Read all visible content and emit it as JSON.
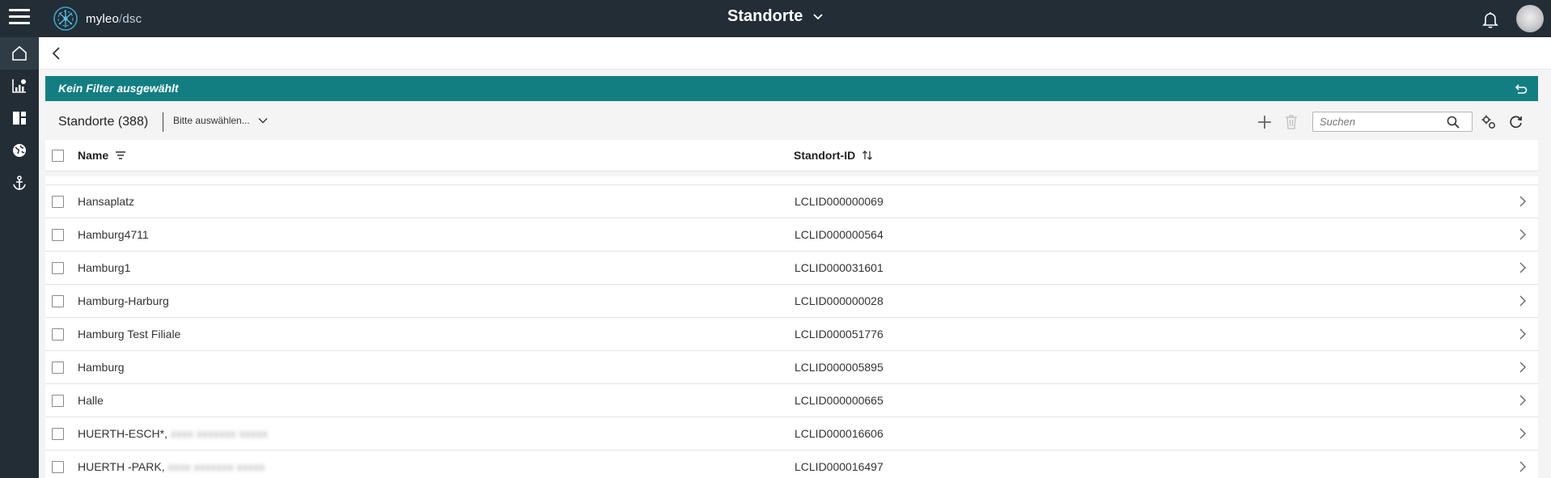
{
  "app": {
    "logo_name": "myleo",
    "logo_sep": "/",
    "logo_product": "dsc",
    "page_title": "Standorte"
  },
  "icons": {
    "menu": "hamburger-icon",
    "title_dropdown": "chevron-down-icon",
    "notifications": "bell-icon",
    "back": "chevron-left-icon",
    "filter_reset": "undo-icon",
    "add": "plus-icon",
    "delete": "trash-icon",
    "search": "search-icon",
    "settings": "settings-icon",
    "refresh": "refresh-icon",
    "row_open": "chevron-right-icon"
  },
  "rail": [
    {
      "name": "home-icon",
      "active": true
    },
    {
      "name": "chart-icon",
      "active": false
    },
    {
      "name": "dashboard-icon",
      "active": false
    },
    {
      "name": "globe-icon",
      "active": false
    },
    {
      "name": "anchor-icon",
      "active": false
    }
  ],
  "filter": {
    "text": "Kein Filter ausgewählt"
  },
  "toolbar": {
    "title": "Standorte (388)",
    "select_value": "Bitte auswählen...",
    "search_placeholder": "Suchen"
  },
  "table": {
    "columns": [
      "Name",
      "Standort-ID"
    ],
    "rows": [
      {
        "name": "Hansaplatz",
        "suffix": "",
        "id": "LCLID000000069"
      },
      {
        "name": "Hamburg4711",
        "suffix": "",
        "id": "LCLID000000564"
      },
      {
        "name": "Hamburg1",
        "suffix": "",
        "id": "LCLID000031601"
      },
      {
        "name": "Hamburg-Harburg",
        "suffix": "",
        "id": "LCLID000000028"
      },
      {
        "name": "Hamburg Test Filiale",
        "suffix": "",
        "id": "LCLID000051776"
      },
      {
        "name": "Hamburg",
        "suffix": "",
        "id": "LCLID000005895"
      },
      {
        "name": "Halle",
        "suffix": "",
        "id": "LCLID000000665"
      },
      {
        "name": "HUERTH-ESCH*,",
        "suffix": "blurred",
        "id": "LCLID000016606"
      },
      {
        "name": "HUERTH -PARK,",
        "suffix": "blurred",
        "id": "LCLID000016497"
      }
    ]
  },
  "colors": {
    "topbar": "#232d35",
    "filterbar": "#137e82"
  }
}
